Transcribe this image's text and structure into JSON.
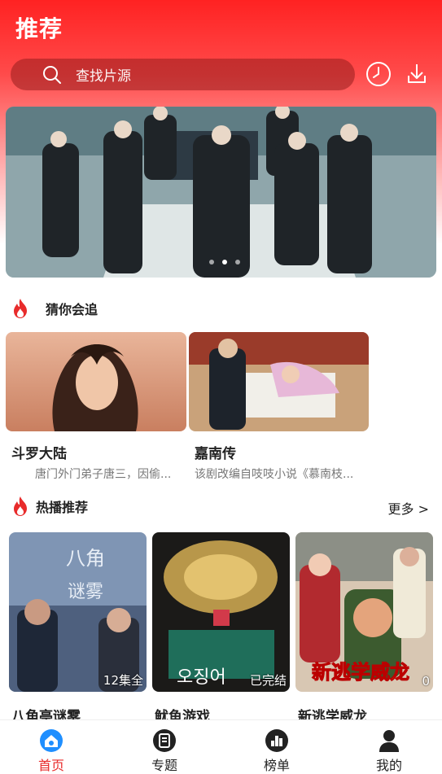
{
  "header": {
    "title": "推荐",
    "search_placeholder": "查找片源"
  },
  "banner": {
    "dots_count": 3,
    "active_index": 1
  },
  "guess": {
    "title": "猜你会追",
    "items": [
      {
        "title": "斗罗大陆",
        "desc": "唐门外门弟子唐三，因偷..."
      },
      {
        "title": "嘉南传",
        "desc": "该剧改编自吱吱小说《慕南枝..."
      }
    ]
  },
  "hot": {
    "title": "热播推荐",
    "more": "更多 >",
    "items": [
      {
        "title": "八角亭谜雾",
        "tag": "12集全"
      },
      {
        "title": "鱿鱼游戏",
        "tag": "已完结"
      },
      {
        "title": "新逃学威龙",
        "tag": "0"
      }
    ]
  },
  "tabs": [
    {
      "label": "首页",
      "active": true
    },
    {
      "label": "专题",
      "active": false
    },
    {
      "label": "榜单",
      "active": false
    },
    {
      "label": "我的",
      "active": false
    }
  ],
  "colors": {
    "accent": "#e82b2b",
    "header_red": "#ff2222"
  }
}
